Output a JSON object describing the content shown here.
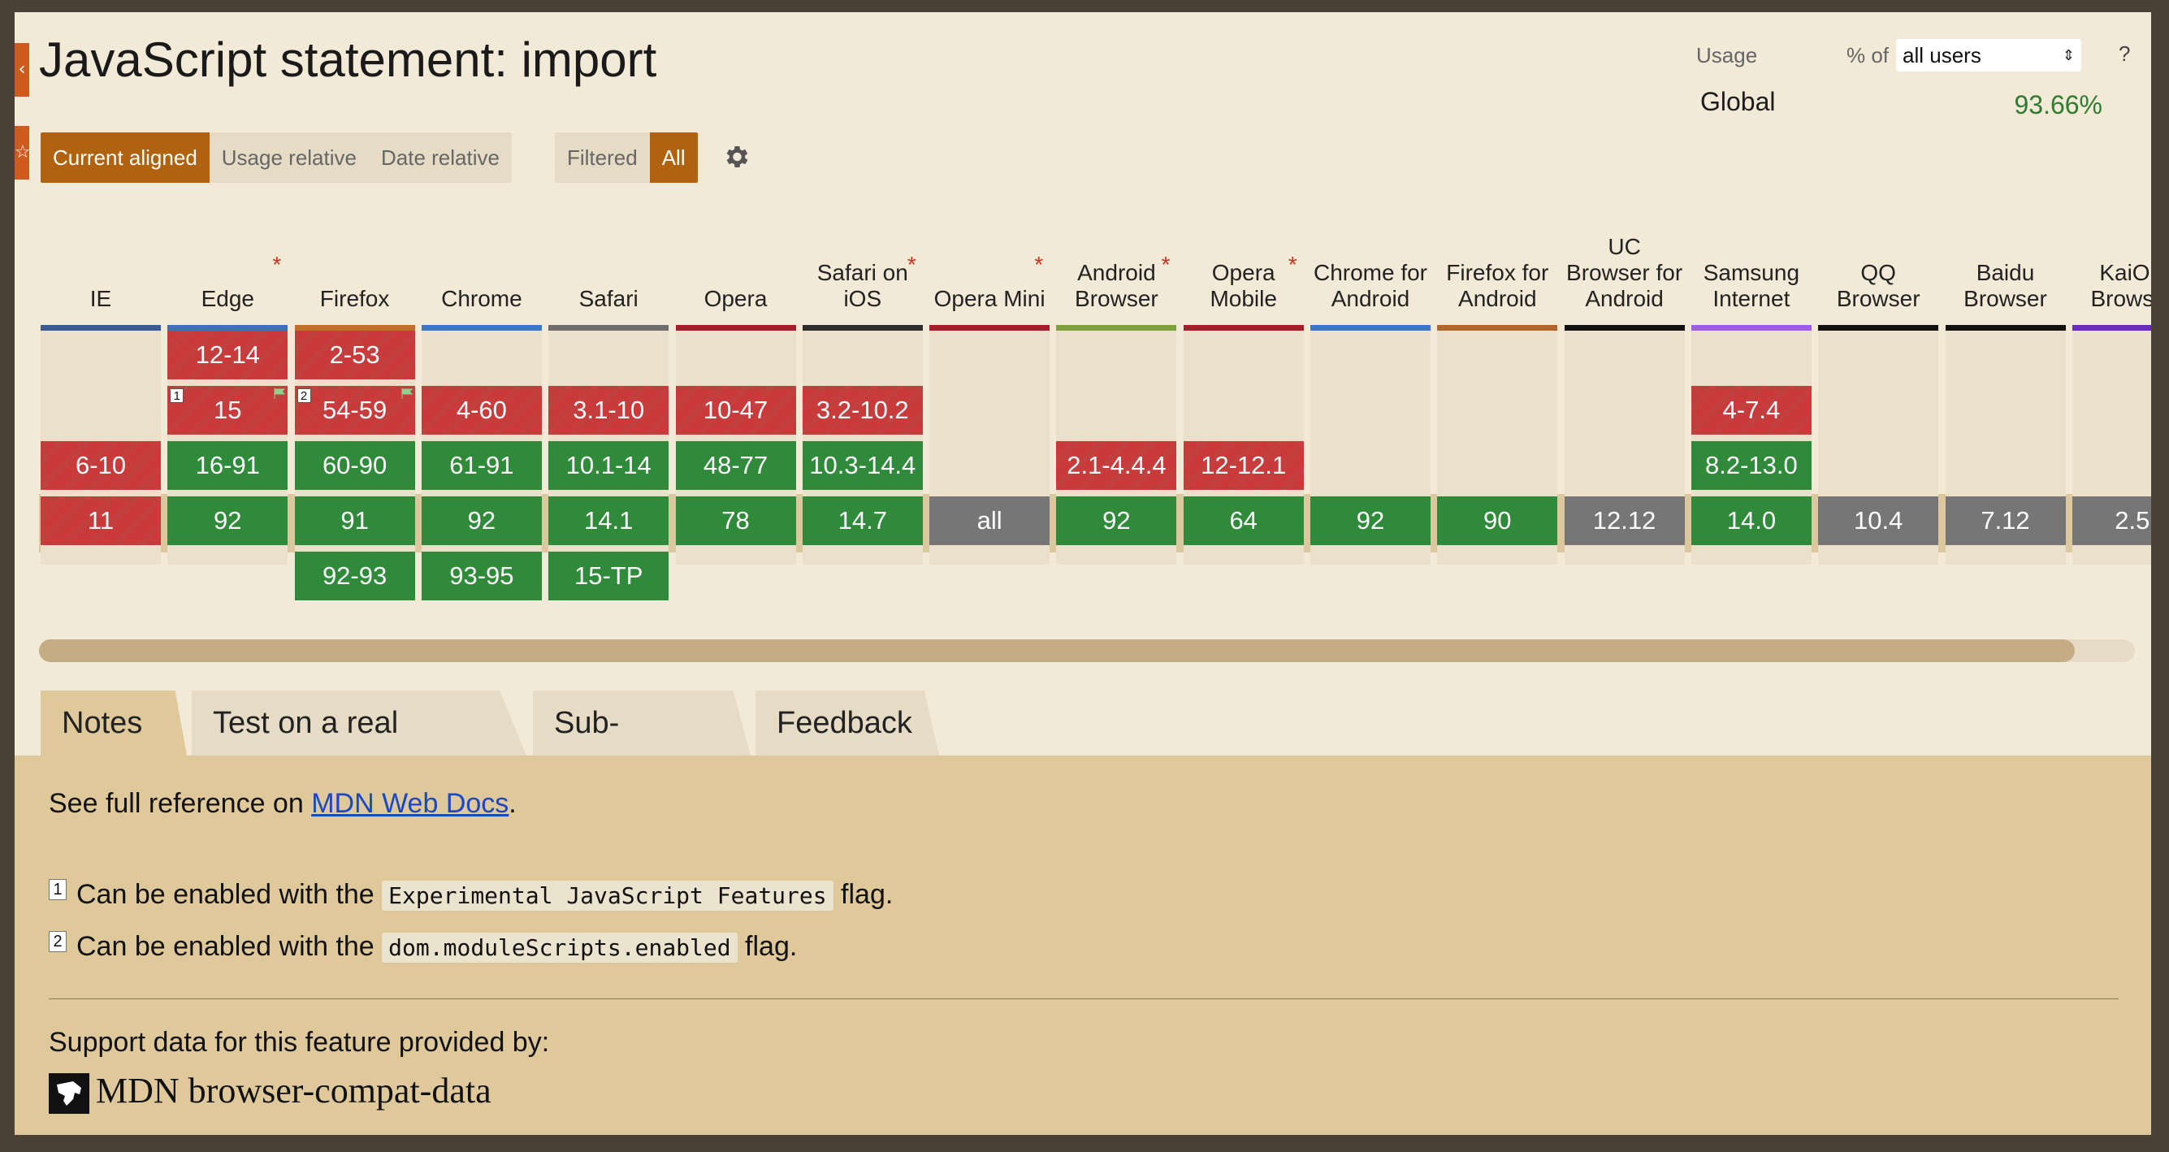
{
  "page": {
    "title": "JavaScript statement: import"
  },
  "toolbar": {
    "view_buttons": [
      "Current aligned",
      "Usage relative",
      "Date relative"
    ],
    "filter_buttons": [
      "Filtered",
      "All"
    ],
    "settings_icon": "gear-icon"
  },
  "usage": {
    "label": "Usage",
    "pct_of": "% of",
    "selected_users": "all users",
    "help": "?",
    "region": "Global",
    "value": "93.66%"
  },
  "browsers": [
    {
      "name": "IE",
      "star": false,
      "color": "#3a5a91",
      "cells": [
        null,
        null,
        {
          "v": "6-10",
          "s": "red"
        },
        {
          "v": "11",
          "s": "red"
        },
        null
      ]
    },
    {
      "name": "Edge",
      "star": true,
      "color": "#3a72b5",
      "cells": [
        {
          "v": "12-14",
          "s": "red"
        },
        {
          "v": "15",
          "s": "red",
          "note": "1",
          "flag": true
        },
        {
          "v": "16-91",
          "s": "green"
        },
        {
          "v": "92",
          "s": "green"
        },
        null
      ]
    },
    {
      "name": "Firefox",
      "star": false,
      "color": "#c0702a",
      "cells": [
        {
          "v": "2-53",
          "s": "red"
        },
        {
          "v": "54-59",
          "s": "red",
          "note": "2",
          "flag": true
        },
        {
          "v": "60-90",
          "s": "green"
        },
        {
          "v": "91",
          "s": "green"
        },
        {
          "v": "92-93",
          "s": "green"
        }
      ]
    },
    {
      "name": "Chrome",
      "star": false,
      "color": "#3a78c6",
      "cells": [
        null,
        {
          "v": "4-60",
          "s": "red"
        },
        {
          "v": "61-91",
          "s": "green"
        },
        {
          "v": "92",
          "s": "green"
        },
        {
          "v": "93-95",
          "s": "green"
        }
      ]
    },
    {
      "name": "Safari",
      "star": false,
      "color": "#6d6d6d",
      "cells": [
        null,
        {
          "v": "3.1-10",
          "s": "red"
        },
        {
          "v": "10.1-14",
          "s": "green"
        },
        {
          "v": "14.1",
          "s": "green"
        },
        {
          "v": "15-TP",
          "s": "green"
        }
      ]
    },
    {
      "name": "Opera",
      "star": false,
      "color": "#a3202a",
      "cells": [
        null,
        {
          "v": "10-47",
          "s": "red"
        },
        {
          "v": "48-77",
          "s": "green"
        },
        {
          "v": "78",
          "s": "green"
        },
        null
      ]
    },
    {
      "name": "Safari on iOS",
      "star": true,
      "color": "#2e2e2e",
      "cells": [
        null,
        {
          "v": "3.2-10.2",
          "s": "red"
        },
        {
          "v": "10.3-14.4",
          "s": "green"
        },
        {
          "v": "14.7",
          "s": "green"
        },
        null
      ]
    },
    {
      "name": "Opera Mini",
      "star": true,
      "color": "#a3202a",
      "cells": [
        null,
        null,
        null,
        {
          "v": "all",
          "s": "gray"
        },
        null
      ]
    },
    {
      "name": "Android Browser",
      "star": true,
      "color": "#7ea03c",
      "cells": [
        null,
        null,
        {
          "v": "2.1-4.4.4",
          "s": "red"
        },
        {
          "v": "92",
          "s": "green"
        },
        null
      ]
    },
    {
      "name": "Opera Mobile",
      "star": true,
      "color": "#a3202a",
      "cells": [
        null,
        null,
        {
          "v": "12-12.1",
          "s": "red"
        },
        {
          "v": "64",
          "s": "green"
        },
        null
      ]
    },
    {
      "name": "Chrome for Android",
      "star": false,
      "color": "#3a78c6",
      "cells": [
        null,
        null,
        null,
        {
          "v": "92",
          "s": "green"
        },
        null
      ]
    },
    {
      "name": "Firefox for Android",
      "star": false,
      "color": "#b0662a",
      "cells": [
        null,
        null,
        null,
        {
          "v": "90",
          "s": "green"
        },
        null
      ]
    },
    {
      "name": "UC Browser for Android",
      "star": false,
      "color": "#111111",
      "cells": [
        null,
        null,
        null,
        {
          "v": "12.12",
          "s": "gray"
        },
        null
      ]
    },
    {
      "name": "Samsung Internet",
      "star": false,
      "color": "#9b5de5",
      "cells": [
        null,
        {
          "v": "4-7.4",
          "s": "red"
        },
        {
          "v": "8.2-13.0",
          "s": "green"
        },
        {
          "v": "14.0",
          "s": "green"
        },
        null
      ]
    },
    {
      "name": "QQ Browser",
      "star": false,
      "color": "#111111",
      "cells": [
        null,
        null,
        null,
        {
          "v": "10.4",
          "s": "gray"
        },
        null
      ]
    },
    {
      "name": "Baidu Browser",
      "star": false,
      "color": "#111111",
      "cells": [
        null,
        null,
        null,
        {
          "v": "7.12",
          "s": "gray"
        },
        null
      ]
    },
    {
      "name": "KaiOS Browser",
      "star": false,
      "color": "#6a2cbf",
      "cells": [
        null,
        null,
        null,
        {
          "v": "2.5",
          "s": "gray"
        },
        null
      ]
    }
  ],
  "tabs": [
    "Notes",
    "Test on a real browser",
    "Sub-features",
    "Feedback"
  ],
  "notes": {
    "ref_prefix": "See full reference on ",
    "ref_link": "MDN Web Docs",
    "ref_suffix": ".",
    "note1_num": "1",
    "note1_prefix": "Can be enabled with the ",
    "note1_code": "Experimental JavaScript Features",
    "note1_suffix": " flag.",
    "note2_num": "2",
    "note2_prefix": "Can be enabled with the ",
    "note2_code": "dom.moduleScripts.enabled",
    "note2_suffix": " flag.",
    "support_label": "Support data for this feature provided by:",
    "provider": "MDN browser-compat-data"
  }
}
